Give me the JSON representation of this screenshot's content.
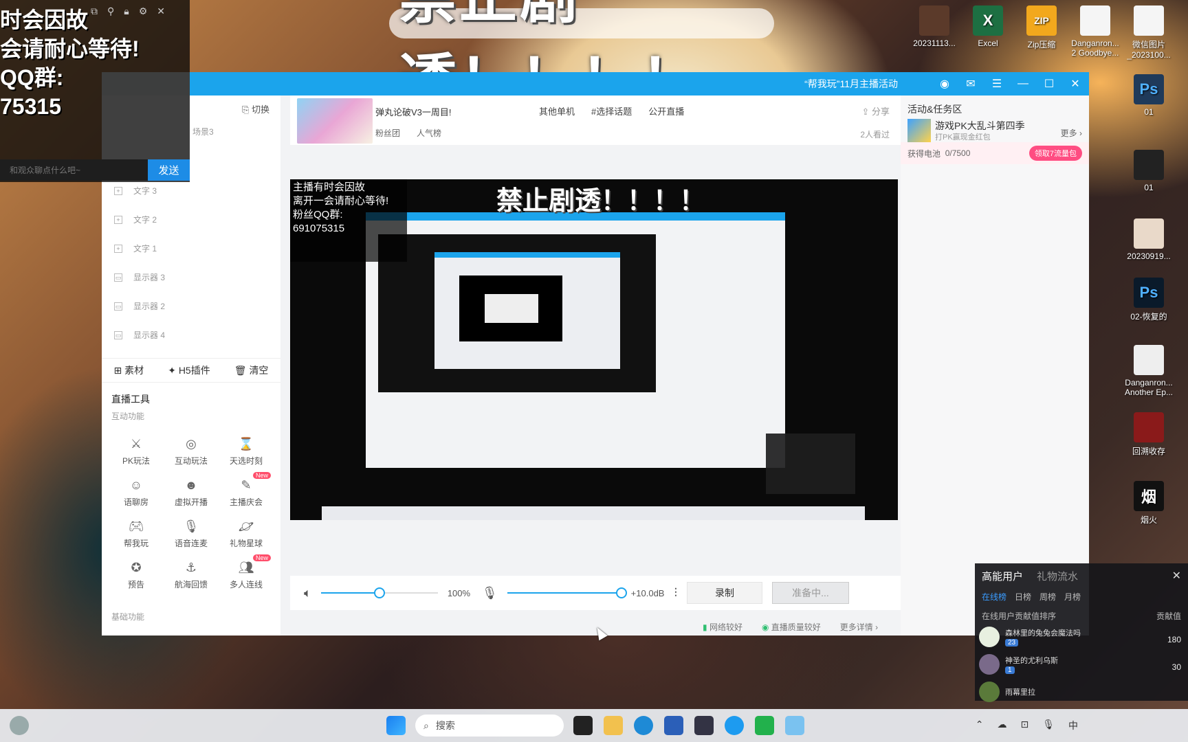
{
  "banner": {
    "text": "禁止剧透！！！！"
  },
  "overlay": {
    "text": "时会因故\n会请耐心等待!\nQQ群:\n75315",
    "chat_placeholder": "和观众聊点什么吧~",
    "send_label": "发送"
  },
  "titlebar": {
    "event": "“帮我玩”11月主播活动"
  },
  "left_panel": {
    "switch_label": "切换",
    "scene": "场景3",
    "sources": [
      "文字 3",
      "文字 2",
      "文字 1",
      "显示器 3",
      "显示器 2",
      "显示器 4"
    ],
    "tabs": [
      "素材",
      "H5插件",
      "清空"
    ],
    "live_tools_title": "直播工具",
    "interactive_title": "互动功能",
    "tools": [
      {
        "label": "PK玩法",
        "icon": "pk-icon",
        "new": ""
      },
      {
        "label": "互动玩法",
        "icon": "interact-icon",
        "new": ""
      },
      {
        "label": "天选时刻",
        "icon": "lucky-icon",
        "new": ""
      },
      {
        "label": "语聊房",
        "icon": "voice-room-icon",
        "new": ""
      },
      {
        "label": "虚拟开播",
        "icon": "virtual-icon",
        "new": ""
      },
      {
        "label": "主播庆会",
        "icon": "celebrate-icon",
        "new": "New"
      },
      {
        "label": "帮我玩",
        "icon": "gamepad-icon",
        "new": ""
      },
      {
        "label": "语音连麦",
        "icon": "mic-link-icon",
        "new": ""
      },
      {
        "label": "礼物星球",
        "icon": "planet-icon",
        "new": ""
      },
      {
        "label": "预告",
        "icon": "star-icon",
        "new": ""
      },
      {
        "label": "航海回馈",
        "icon": "anchor-icon",
        "new": ""
      },
      {
        "label": "多人连线",
        "icon": "multi-user-icon",
        "new": "New"
      }
    ],
    "basic_title": "基础功能"
  },
  "header": {
    "stream_title": "弹丸论破V3一周目!",
    "links": [
      "其他单机",
      "#选择话题",
      "公开直播"
    ],
    "share": "分享",
    "fans": "粉丝团",
    "popularity": "人气榜",
    "watching": "2人看过"
  },
  "preview": {
    "banner": "禁止剧透！！！！",
    "overlay": "主播有时会因故\n离开一会请耐心等待!\n粉丝QQ群:\n691075315"
  },
  "controls": {
    "volume": "100%",
    "volume_level": 0.5,
    "mic_gain": "+10.0dB",
    "mic_level": 1.0,
    "record_label": "录制",
    "start_label": "准备中..."
  },
  "status": {
    "network": "网络较好",
    "quality": "直播质量较好",
    "more": "更多详情"
  },
  "right_panel": {
    "title": "活动&任务区",
    "game": "游戏PK大乱斗第四季",
    "game_sub": "打PK赢现金红包",
    "more": "更多",
    "energy": "获得电池",
    "energy_value": "0/7500",
    "claim": "领取7流量包"
  },
  "desktop_icons": [
    {
      "label": "20231113...",
      "color": "#5b3a2a"
    },
    {
      "label": "Excel",
      "color": "#1d6f42"
    },
    {
      "label": "Zip压缩",
      "color": "#f2a81d"
    },
    {
      "label": "Danganron...\n2 Goodbye...",
      "color": "#f5f5f5"
    },
    {
      "label": "微信图片\n_2023100...",
      "color": "#f5f5f5"
    },
    {
      "label": "01",
      "color": "#1f3a5a"
    },
    {
      "label": "01",
      "color": "#222"
    },
    {
      "label": "20230919...",
      "color": "#e9d9c9"
    },
    {
      "label": "02-恢复的",
      "color": "#0a1a2a"
    },
    {
      "label": "Danganron...\nAnother Ep...",
      "color": "#eee"
    },
    {
      "label": "回溯收存",
      "color": "#8a1a1a"
    },
    {
      "label": "烟火",
      "color": "#111"
    }
  ],
  "gift_panel": {
    "tabs": [
      "高能用户",
      "礼物流水"
    ],
    "subtabs": [
      "在线榜",
      "日榜",
      "周榜",
      "月榜"
    ],
    "ranking_title": "在线用户贡献值排序",
    "contrib": "贡献值",
    "users": [
      {
        "name": "森林里的兔兔会魔法吗",
        "level": "23",
        "value": "180"
      },
      {
        "name": "神圣的尤利乌斯",
        "level": "1",
        "value": "30"
      },
      {
        "name": "雨幕里拉",
        "level": "",
        "value": ""
      }
    ]
  },
  "taskbar": {
    "search": "搜索",
    "ime": "中"
  }
}
